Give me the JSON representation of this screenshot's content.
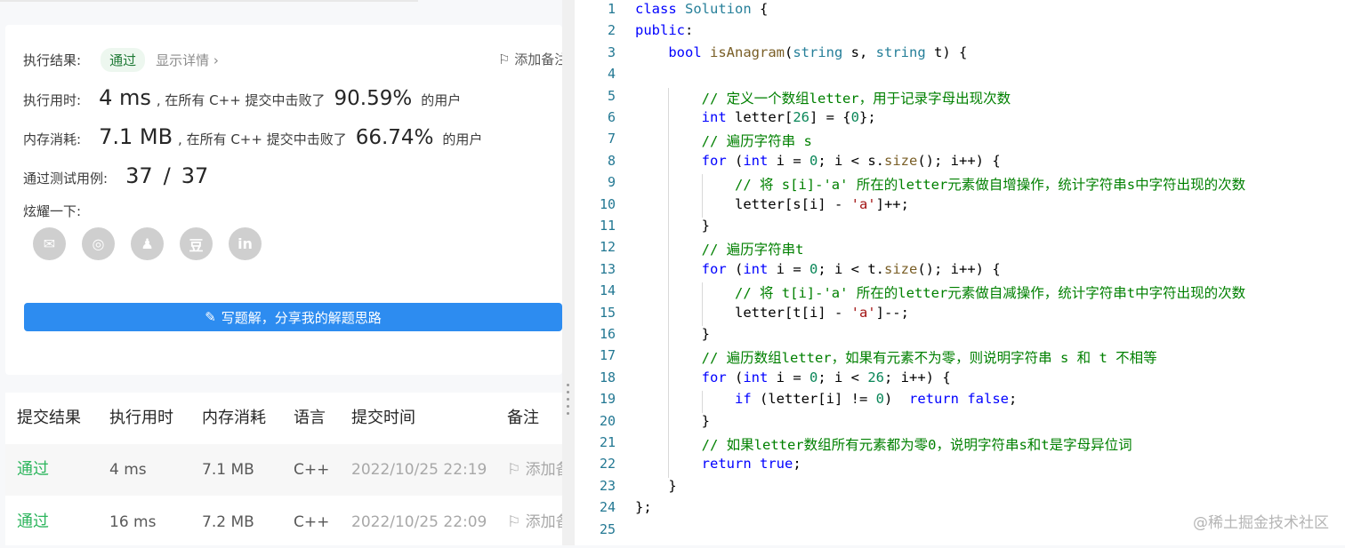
{
  "result": {
    "label": "执行结果:",
    "status": "通过",
    "detail_link": "显示详情 ›",
    "add_note": "添加备注"
  },
  "runtime": {
    "label": "执行用时:",
    "value": "4 ms",
    "beat_text": ", 在所有 C++ 提交中击败了",
    "percent": "90.59%",
    "suffix": "的用户"
  },
  "memory": {
    "label": "内存消耗:",
    "value": "7.1 MB",
    "beat_text": ", 在所有 C++ 提交中击败了",
    "percent": "66.74%",
    "suffix": "的用户"
  },
  "testcases": {
    "label": "通过测试用例:",
    "passed": "37",
    "sep": "/",
    "total": "37"
  },
  "share": {
    "label": "炫耀一下:",
    "icons": [
      "wechat-icon",
      "weibo-icon",
      "qq-icon",
      "douban-icon",
      "linkedin-icon"
    ],
    "glyphs": [
      "✉",
      "◎",
      "♟",
      "豆",
      "in"
    ]
  },
  "solution_button": "写题解，分享我的解题思路",
  "submissions": {
    "headers": [
      "提交结果",
      "执行用时",
      "内存消耗",
      "语言",
      "提交时间",
      "备注"
    ],
    "rows": [
      {
        "result": "通过",
        "time": "4 ms",
        "memory": "7.1 MB",
        "lang": "C++",
        "date": "2022/10/25 22:19",
        "note": "添加备注"
      },
      {
        "result": "通过",
        "time": "16 ms",
        "memory": "7.2 MB",
        "lang": "C++",
        "date": "2022/10/25 22:09",
        "note": "添加备注"
      }
    ]
  },
  "code_lines": [
    "class Solution {",
    "public:",
    "    bool isAnagram(string s, string t) {",
    "",
    "        // 定义一个数组letter，用于记录字母出现次数",
    "        int letter[26] = {0};",
    "        // 遍历字符串 s",
    "        for (int i = 0; i < s.size(); i++) {",
    "            // 将 s[i]-'a' 所在的letter元素做自增操作，统计字符串s中字符出现的次数",
    "            letter[s[i] - 'a']++;",
    "        }",
    "        // 遍历字符串t",
    "        for (int i = 0; i < t.size(); i++) {",
    "            // 将 t[i]-'a' 所在的letter元素做自减操作，统计字符串t中字符出现的次数",
    "            letter[t[i] - 'a']--;",
    "        }",
    "        // 遍历数组letter，如果有元素不为零，则说明字符串 s 和 t 不相等",
    "        for (int i = 0; i < 26; i++) {",
    "            if (letter[i] != 0)  return false;",
    "        }",
    "        // 如果letter数组所有元素都为零0，说明字符串s和t是字母异位词",
    "        return true;",
    "    }",
    "};",
    ""
  ],
  "watermark": "@稀土掘金技术社区",
  "colors": {
    "keyword": "#0000ff",
    "type": "#267f99",
    "comment": "#008000",
    "string": "#a31515",
    "number": "#098658",
    "accepted": "#2db55d",
    "button": "#2d8cf0"
  }
}
